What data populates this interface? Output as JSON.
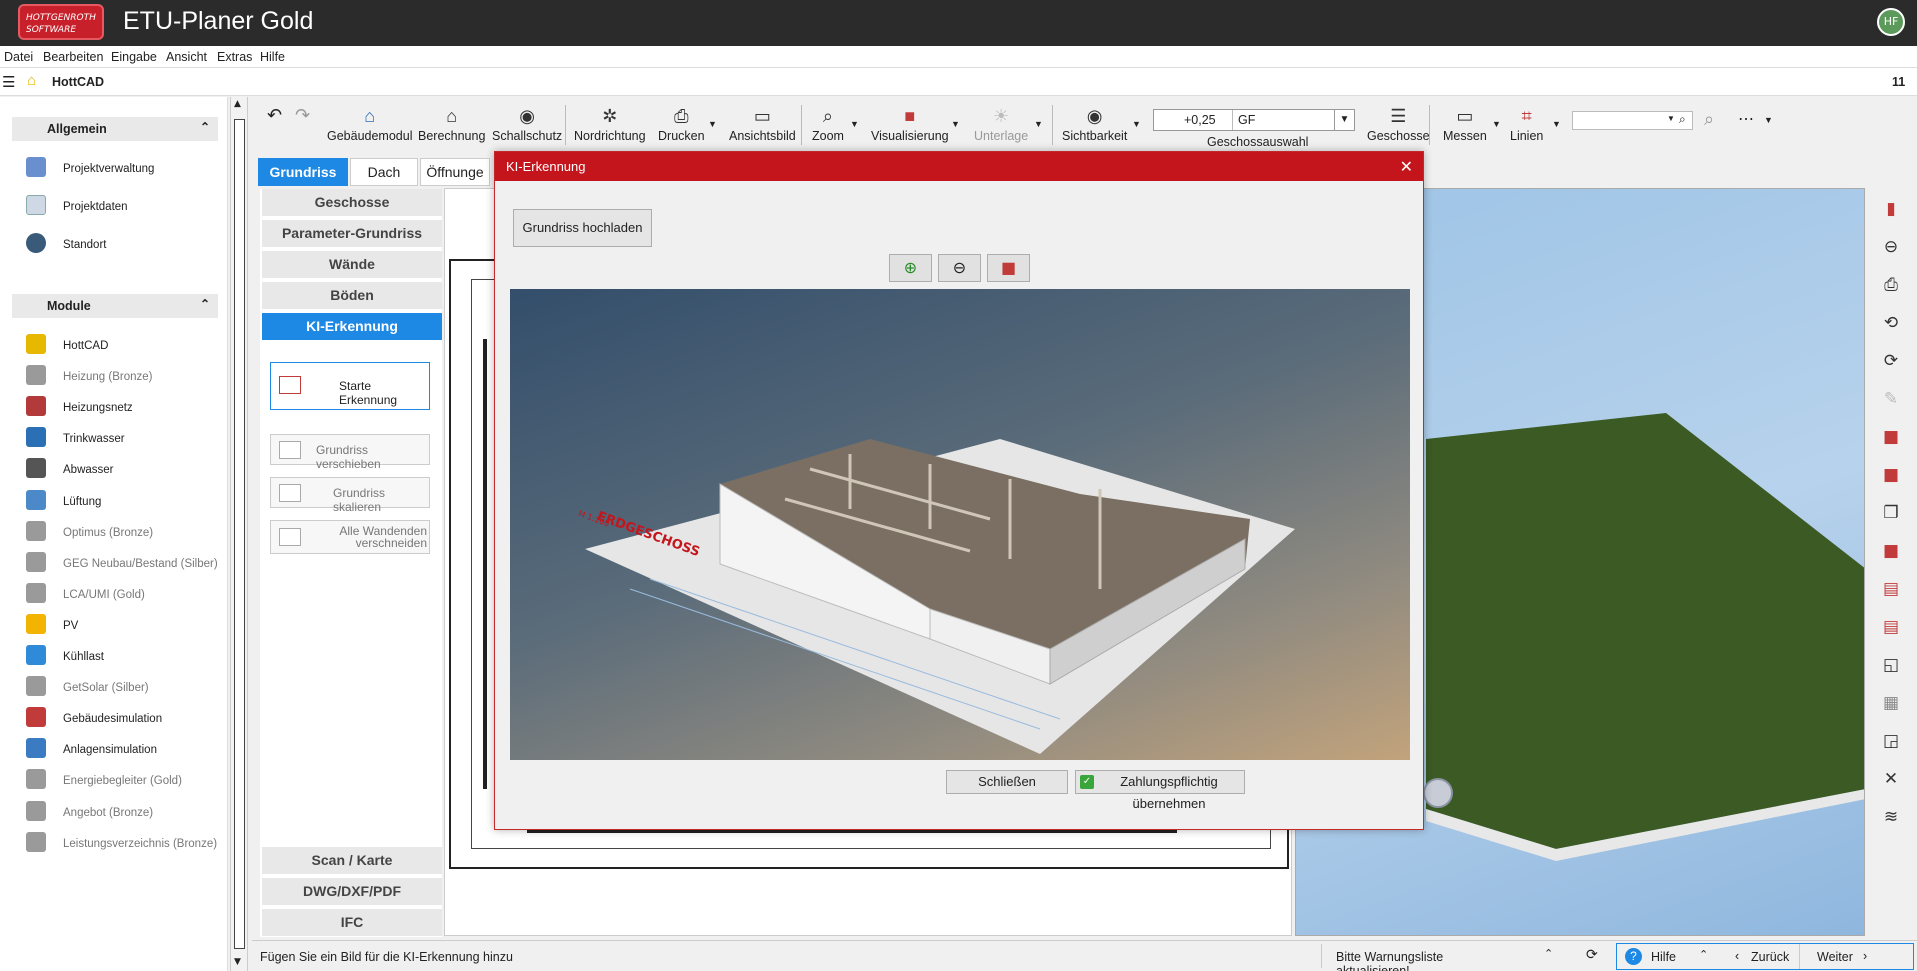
{
  "app": {
    "title": "ETU-Planer Gold",
    "logo_text": "HOTTGENROTH SOFTWARE",
    "user_initials": "HF"
  },
  "menu": [
    "Datei",
    "Bearbeiten",
    "Eingabe",
    "Ansicht",
    "Extras",
    "Hilfe"
  ],
  "module_header": {
    "title": "HottCAD",
    "counter": "11"
  },
  "sidebar": {
    "group_general": "Allgemein",
    "general_items": [
      "Projektverwaltung",
      "Projektdaten",
      "Standort"
    ],
    "group_modules": "Module",
    "module_items": [
      {
        "label": "HottCAD",
        "enabled": true,
        "color": "#e6b800"
      },
      {
        "label": "Heizung (Bronze)",
        "enabled": false,
        "color": "#9a9a9a"
      },
      {
        "label": "Heizungsnetz",
        "enabled": true,
        "color": "#b23a3a"
      },
      {
        "label": "Trinkwasser",
        "enabled": true,
        "color": "#2b6fb5"
      },
      {
        "label": "Abwasser",
        "enabled": true,
        "color": "#555555"
      },
      {
        "label": "Lüftung",
        "enabled": true,
        "color": "#4b89c8"
      },
      {
        "label": "Optimus (Bronze)",
        "enabled": false,
        "color": "#9a9a9a"
      },
      {
        "label": "GEG Neubau/Bestand (Silber)",
        "enabled": false,
        "color": "#9a9a9a"
      },
      {
        "label": "LCA/UMI (Gold)",
        "enabled": false,
        "color": "#9a9a9a"
      },
      {
        "label": "PV",
        "enabled": true,
        "color": "#f2b400"
      },
      {
        "label": "Kühllast",
        "enabled": true,
        "color": "#2f8ad8"
      },
      {
        "label": "GetSolar (Silber)",
        "enabled": false,
        "color": "#9a9a9a"
      },
      {
        "label": "Gebäudesimulation",
        "enabled": true,
        "color": "#c23b3b"
      },
      {
        "label": "Anlagensimulation",
        "enabled": true,
        "color": "#3b7bc2"
      },
      {
        "label": "Energiebegleiter (Gold)",
        "enabled": false,
        "color": "#9a9a9a"
      },
      {
        "label": "Angebot (Bronze)",
        "enabled": false,
        "color": "#9a9a9a"
      },
      {
        "label": "Leistungsverzeichnis (Bronze)",
        "enabled": false,
        "color": "#9a9a9a"
      }
    ]
  },
  "toolbar": {
    "gebaeudemodul": "Gebäudemodul",
    "berechnung": "Berechnung",
    "schallschutz": "Schallschutz",
    "nordrichtung": "Nordrichtung",
    "drucken": "Drucken",
    "ansichtsbild": "Ansichtsbild",
    "zoom": "Zoom",
    "visualisierung": "Visualisierung",
    "unterlage": "Unterlage",
    "sichtbarkeit": "Sichtbarkeit",
    "floor_height": "+0,25",
    "floor_name": "GF",
    "geschossauswahl": "Geschossauswahl",
    "geschosse": "Geschosse",
    "messen": "Messen",
    "linien": "Linien"
  },
  "tabs": [
    "Grundriss",
    "Dach",
    "Öffnunge"
  ],
  "panel": {
    "nav_top": [
      "Geschosse",
      "Parameter-Grundriss",
      "Wände",
      "Böden",
      "KI-Erkennung"
    ],
    "start_btn": "Starte Erkennung",
    "action_move": "Grundriss verschieben",
    "action_scale": "Grundriss skalieren",
    "action_cut": "Alle Wandenden verschneiden",
    "nav_bottom": [
      "Scan / Karte",
      "DWG/DXF/PDF",
      "IFC"
    ]
  },
  "dialog": {
    "title": "KI-Erkennung",
    "upload_btn": "Grundriss hochladen",
    "render_label": "ERDGESCHOSS",
    "render_scale": "M 1:100",
    "close_btn": "Schließen",
    "accept_btn": "Zahlungspflichtig übernehmen"
  },
  "status": {
    "message": "Fügen Sie ein Bild für die KI-Erkennung hinzu",
    "warning": "Bitte Warnungsliste aktualisieren!",
    "help": "Hilfe",
    "back": "Zurück",
    "next": "Weiter"
  },
  "colors": {
    "accent": "#1e88e5",
    "dialog_title": "#c4151c",
    "titlebar": "#2b2b2b"
  }
}
